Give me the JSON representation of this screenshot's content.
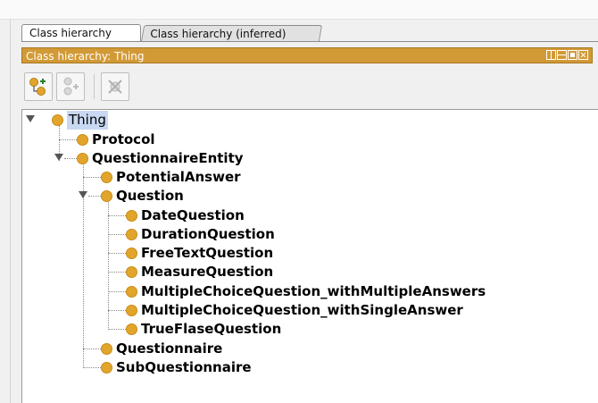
{
  "tabs": [
    {
      "label": "Class hierarchy",
      "active": true
    },
    {
      "label": "Class hierarchy (inferred)",
      "active": false
    }
  ],
  "panel": {
    "title": "Class hierarchy: Thing",
    "accent_color": "#d29a36"
  },
  "toolbar": {
    "buttons": [
      {
        "icon": "add-subclass-icon",
        "enabled": true
      },
      {
        "icon": "add-sibling-class-icon",
        "enabled": false
      },
      {
        "icon": "delete-class-icon",
        "enabled": false
      }
    ]
  },
  "tree": {
    "node_color": "#e2a52c",
    "nodes": [
      {
        "label": "Thing",
        "depth": 0,
        "expanded": true,
        "selected": true
      },
      {
        "label": "Protocol",
        "depth": 1
      },
      {
        "label": "QuestionnaireEntity",
        "depth": 1,
        "expanded": true
      },
      {
        "label": "PotentialAnswer",
        "depth": 2
      },
      {
        "label": "Question",
        "depth": 2,
        "expanded": true
      },
      {
        "label": "DateQuestion",
        "depth": 3
      },
      {
        "label": "DurationQuestion",
        "depth": 3
      },
      {
        "label": "FreeTextQuestion",
        "depth": 3
      },
      {
        "label": "MeasureQuestion",
        "depth": 3
      },
      {
        "label": "MultipleChoiceQuestion_withMultipleAnswers",
        "depth": 3
      },
      {
        "label": "MultipleChoiceQuestion_withSingleAnswer",
        "depth": 3
      },
      {
        "label": "TrueFlaseQuestion",
        "depth": 3
      },
      {
        "label": "Questionnaire",
        "depth": 2
      },
      {
        "label": "SubQuestionnaire",
        "depth": 2
      }
    ]
  }
}
